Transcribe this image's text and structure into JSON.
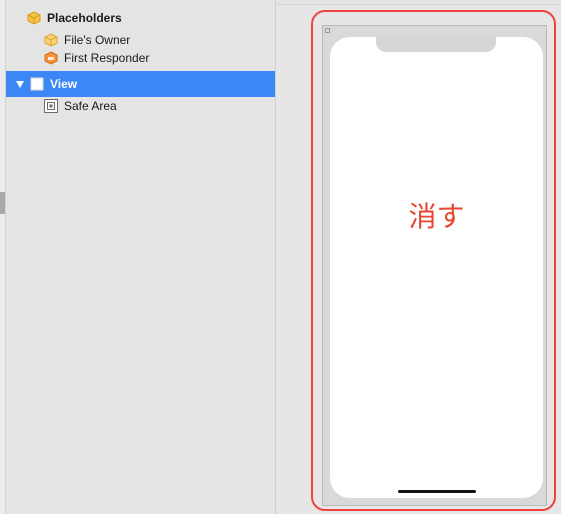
{
  "outline": {
    "items": [
      {
        "label": "Placeholders",
        "icon": "placeholder-cube-icon",
        "bold": true,
        "selected": false
      },
      {
        "label": "File's Owner",
        "icon": "files-owner-cube-icon",
        "bold": false,
        "selected": false
      },
      {
        "label": "First Responder",
        "icon": "first-responder-cube-icon",
        "bold": false,
        "selected": false
      },
      {
        "label": "View",
        "icon": "view-icon",
        "bold": true,
        "selected": true,
        "expanded": true
      },
      {
        "label": "Safe Area",
        "icon": "safe-area-icon",
        "bold": false,
        "selected": false
      }
    ]
  },
  "canvas": {
    "button_title": "消す",
    "colors": {
      "selection": "#3a87f5",
      "highlight_border": "#f0413d",
      "button_title": "#e8452f"
    }
  }
}
